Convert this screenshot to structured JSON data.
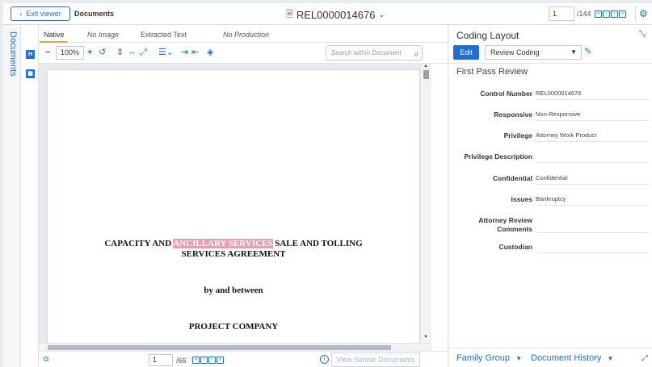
{
  "topbar": {
    "exit_label": "Exit viewer",
    "crumb": "Documents",
    "doc_title": "REL0000014676",
    "page_current": "1",
    "page_total": "/144"
  },
  "rail": {
    "documents_label": "Documents"
  },
  "viewer": {
    "tabs": [
      "Native",
      "No Image",
      "Extracted Text",
      "No Production"
    ],
    "zoom": "100%",
    "search_placeholder": "Search within Document",
    "doc_lines": {
      "line1_pre": "CAPACITY AND ",
      "line1_hl": "ANCILLARY SERVICES",
      "line1_post": " SALE AND TOLLING",
      "line2": "SERVICES AGREEMENT",
      "line3": "by and between",
      "line4": "PROJECT COMPANY"
    },
    "footer": {
      "page_current": "1",
      "page_total": "/66",
      "similar_label": "View Similar Documents"
    }
  },
  "coding": {
    "title": "Coding Layout",
    "edit_label": "Edit",
    "layout_selected": "Review Coding",
    "section": "First Pass Review",
    "fields": [
      {
        "label": "Control Number",
        "value": "REL0000014676"
      },
      {
        "label": "Responsive",
        "value": "Non-Responsive"
      },
      {
        "label": "Privilege",
        "value": "Attorney Work Product"
      },
      {
        "label": "Privilege Description",
        "value": ""
      },
      {
        "label": "Confidential",
        "value": "Confidential"
      },
      {
        "label": "Issues",
        "value": "Bankruptcy"
      },
      {
        "label": "Attorney Review Comments",
        "value": ""
      },
      {
        "label": "Custodian",
        "value": ""
      }
    ],
    "footer": {
      "family_group": "Family Group",
      "document_history": "Document History"
    }
  },
  "colors": {
    "accent": "#1f6fd1",
    "highlight": "#e8a0b0"
  }
}
